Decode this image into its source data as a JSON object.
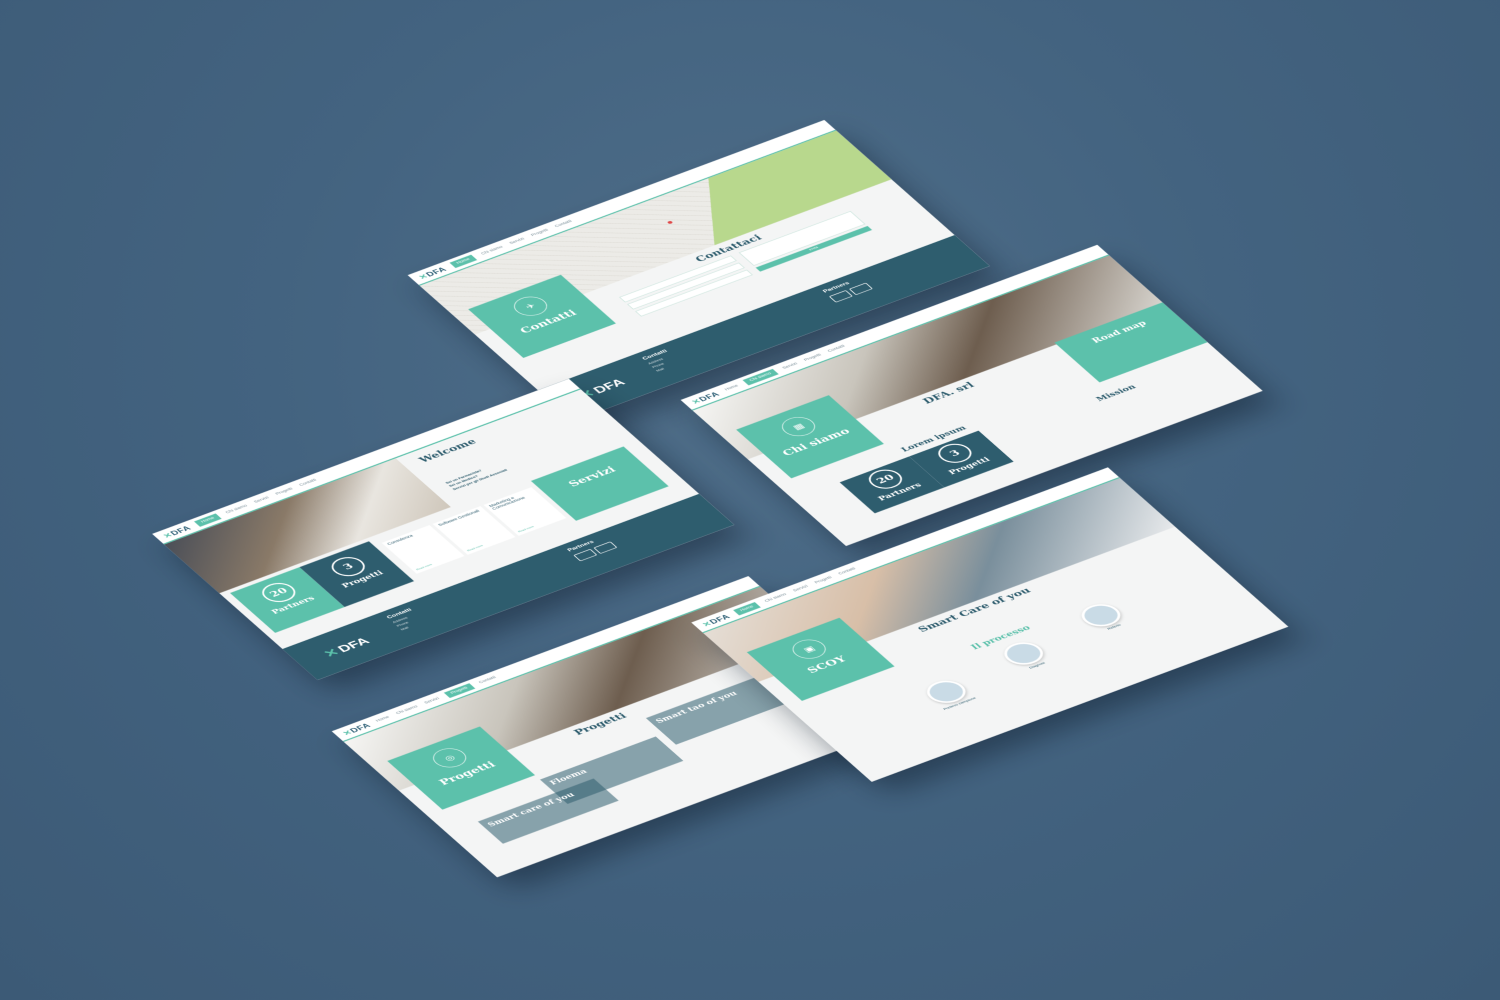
{
  "brand": {
    "logo": "DFA",
    "accent": "#5cc1ab",
    "dark": "#2e5d6e",
    "background": "#436380"
  },
  "nav": {
    "home": "Home",
    "about": "Chi siamo",
    "services": "Servizi",
    "projects": "Progetti",
    "news": "News",
    "contacts": "Contatti"
  },
  "footer": {
    "contacts_title": "Contatti",
    "address_label": "Address",
    "phone_label": "Phone",
    "mail_label": "Mail",
    "partners_title": "Partners"
  },
  "contatti_page": {
    "card_title": "Contatti",
    "heading": "Contattaci",
    "send_button": "Invia"
  },
  "home_page": {
    "welcome": "Welcome",
    "card_title": "Servizi",
    "partners_count": "20",
    "partners_label": "Partners",
    "projects_count": "3",
    "projects_label": "Progetti",
    "services": [
      "Consulenza",
      "Software Gestionali",
      "Marketing e Comunicazione"
    ],
    "read_more": "Read more",
    "links": [
      "Sei un Farmacista?",
      "Sei un Medico?",
      "Servizi per gli Studi Associati"
    ]
  },
  "chi_siamo_page": {
    "card_title": "Chi siamo",
    "heading": "DFA. srl",
    "roadmap": "Road map",
    "lorem_ipsum": "Lorem ipsum",
    "partners_count": "20",
    "partners_label": "Partners",
    "projects_count": "3",
    "projects_label": "Progetti",
    "mission": "Mission"
  },
  "progetti_page": {
    "card_title": "Progetti",
    "heading": "Progetti",
    "projects": [
      "Smart tao of you",
      "Floema",
      "Smart care of you"
    ]
  },
  "scoy_page": {
    "card_title": "SCOY",
    "heading": "Smart Care of you",
    "process_heading": "Il processo",
    "steps": [
      "Prelievo campione",
      "Diagnosi",
      "Referto"
    ]
  }
}
